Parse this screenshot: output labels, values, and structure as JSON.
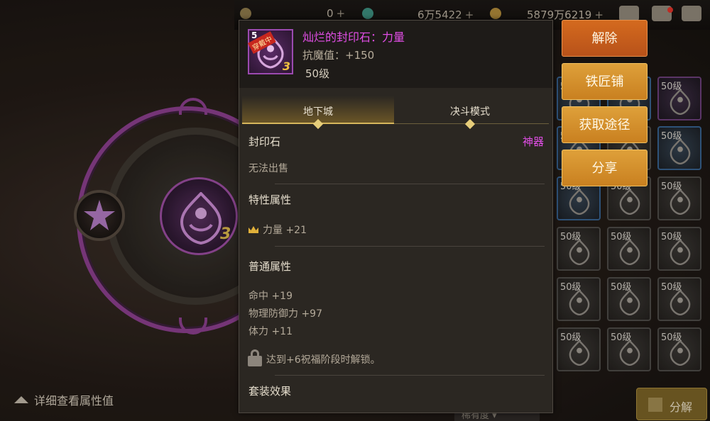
{
  "currency": {
    "c1": "0",
    "c2": "6万5422",
    "c3": "5879万6219",
    "plus": "+"
  },
  "scene": {
    "core_badge": "3",
    "detail_link": "详细查看属性值",
    "decompose_button": "分解",
    "filter_label": "稀有度"
  },
  "item": {
    "icon_tag": "穿戴中",
    "icon_plus": "5",
    "icon_num": "3",
    "name": "灿烂的封印石：力量",
    "stat": "抗魔值：+150",
    "level": "50级"
  },
  "tabs": [
    {
      "label": "地下城"
    },
    {
      "label": "决斗模式"
    }
  ],
  "details": {
    "type": "封印石",
    "rarity": "神器",
    "sell": "无法出售",
    "special_title": "特性属性",
    "special_attr": "力量 +21",
    "normal_title": "普通属性",
    "normal_attrs": [
      "命中 +19",
      "物理防御力 +97",
      "体力 +11"
    ],
    "lock_text": "达到+6祝福阶段时解锁。",
    "set_title": "套装效果"
  },
  "actions": [
    "解除",
    "铁匠铺",
    "获取途径",
    "分享"
  ],
  "slots": {
    "level_label": "50级"
  },
  "colors": {
    "epic": "#e14ee6",
    "button": "#d98f2c",
    "unequip_button": "#c7601d"
  }
}
